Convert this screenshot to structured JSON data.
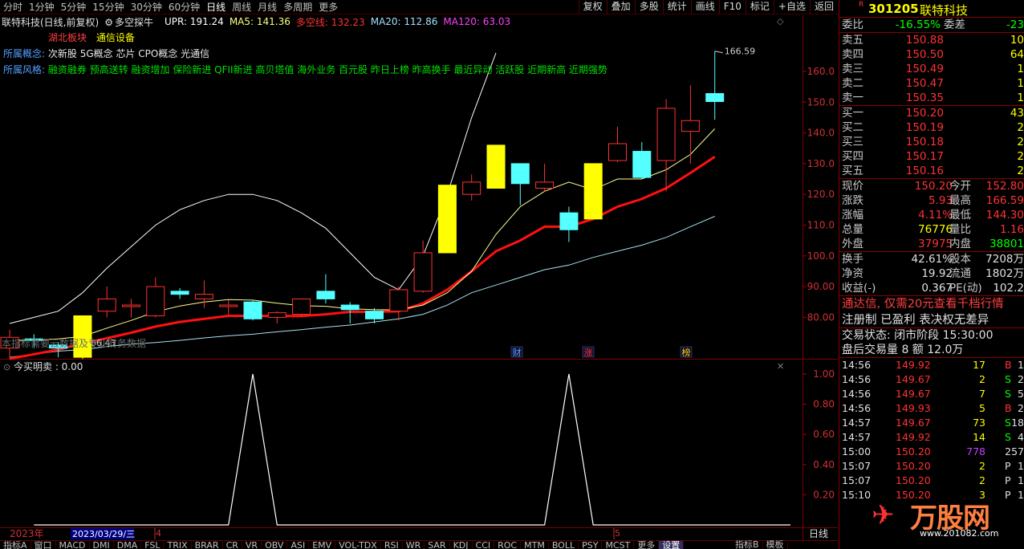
{
  "periods": [
    "分时",
    "1分钟",
    "5分钟",
    "15分钟",
    "30分钟",
    "60分钟",
    "日线",
    "周线",
    "月线",
    "多周期",
    "更多"
  ],
  "active_period": "日线",
  "top_buttons": [
    "复权",
    "叠加",
    "多股",
    "统计",
    "画线",
    "F10",
    "标记",
    "+自选",
    "返回"
  ],
  "stock": {
    "badge": "R",
    "code": "301205",
    "name": "联特科技"
  },
  "info_line": {
    "title": "联特科技(日线,前复权)",
    "indicator": "多空探牛",
    "upr": "UPR: 191.24",
    "ma5": "MA5: 141.36",
    "dkx": "多空线: 132.23",
    "ma20": "MA20: 112.86",
    "ma120": "MA120: 63.03"
  },
  "concepts": {
    "region_label": "湖北板块",
    "industry": "通信设备",
    "concept_label": "所属概念:",
    "concept_values": "次新股 5G概念 芯片 CPO概念 光通信",
    "style_label": "所属风格:",
    "style_values": "融资融券 预高送转 融资增加 保险新进 QFII新进 高贝塔值 海外业务 百元股 昨日上榜 昨高换手 最近异动 活跃股 近期新高 近期强势"
  },
  "chart_note": "本指标需要云数据及专业财务数据",
  "low_label": "66.43",
  "high_label": "166.59",
  "event_markers": [
    "财",
    "涨",
    "榜"
  ],
  "sub_indicator": {
    "label": "今买明卖 : 0.00"
  },
  "date_axis": {
    "year": "2023年",
    "cursor_date": "2023/03/29/三",
    "month4": "4",
    "month5": "5",
    "period_button": "日线"
  },
  "main_axis": [
    "160.0",
    "150.0",
    "140.0",
    "130.0",
    "120.0",
    "110.0",
    "100.0",
    "90.00",
    "80.00"
  ],
  "sub_axis": [
    "1.00",
    "0.80",
    "0.60",
    "0.40",
    "0.20"
  ],
  "colors": {
    "up": "#ff3232",
    "down": "#54ffff",
    "yellow": "#ffff00"
  },
  "candles": [
    {
      "o": 70.0,
      "h": 76.0,
      "l": 67.0,
      "c": 73.5
    },
    {
      "o": 73.0,
      "h": 74.5,
      "l": 70.0,
      "c": 72.5
    },
    {
      "o": 71.0,
      "h": 72.0,
      "l": 67.0,
      "c": 70.0
    },
    {
      "o": 67.0,
      "h": 80.5,
      "l": 66.43,
      "c": 80.5,
      "y": true
    },
    {
      "o": 82.0,
      "h": 90.0,
      "l": 80.0,
      "c": 86.0
    },
    {
      "o": 83.5,
      "h": 86.0,
      "l": 80.0,
      "c": 84.0
    },
    {
      "o": 80.5,
      "h": 93.0,
      "l": 80.0,
      "c": 90.0
    },
    {
      "o": 88.5,
      "h": 89.5,
      "l": 86.0,
      "c": 87.5
    },
    {
      "o": 86.0,
      "h": 92.0,
      "l": 83.0,
      "c": 87.5
    },
    {
      "o": 83.5,
      "h": 85.5,
      "l": 81.0,
      "c": 84.0
    },
    {
      "o": 85.0,
      "h": 85.5,
      "l": 79.0,
      "c": 79.5
    },
    {
      "o": 80.0,
      "h": 82.0,
      "l": 78.0,
      "c": 81.5
    },
    {
      "o": 81.0,
      "h": 84.0,
      "l": 80.0,
      "c": 86.0
    },
    {
      "o": 88.5,
      "h": 94.0,
      "l": 84.5,
      "c": 86.0
    },
    {
      "o": 84.0,
      "h": 85.0,
      "l": 78.0,
      "c": 82.5
    },
    {
      "o": 82.0,
      "h": 83.0,
      "l": 78.0,
      "c": 79.5
    },
    {
      "o": 82.0,
      "h": 90.0,
      "l": 79.0,
      "c": 89.0
    },
    {
      "o": 88.5,
      "h": 105.0,
      "l": 88.0,
      "c": 101.0
    },
    {
      "o": 101.0,
      "h": 123.0,
      "l": 101.0,
      "c": 123.0,
      "y": true
    },
    {
      "o": 120.0,
      "h": 126.5,
      "l": 118.0,
      "c": 124.0
    },
    {
      "o": 122.0,
      "h": 136.0,
      "l": 122.0,
      "c": 136.0,
      "y": true
    },
    {
      "o": 130.0,
      "h": 129.5,
      "l": 116.5,
      "c": 123.5
    },
    {
      "o": 122.0,
      "h": 130.0,
      "l": 121.0,
      "c": 124.0
    },
    {
      "o": 114.0,
      "h": 116.0,
      "l": 104.5,
      "c": 108.5
    },
    {
      "o": 112.0,
      "h": 130.0,
      "l": 112.0,
      "c": 130.0,
      "y": true
    },
    {
      "o": 131.0,
      "h": 142.0,
      "l": 130.5,
      "c": 136.5
    },
    {
      "o": 134.0,
      "h": 137.0,
      "l": 125.0,
      "c": 125.5
    },
    {
      "o": 131.0,
      "h": 151.0,
      "l": 121.0,
      "c": 148.0
    },
    {
      "o": 140.5,
      "h": 155.5,
      "l": 130.0,
      "c": 144.0
    },
    {
      "o": 152.8,
      "h": 166.59,
      "l": 144.3,
      "c": 150.2
    }
  ],
  "ma5": [
    72.5,
    72.6,
    73.0,
    73.8,
    76.5,
    79.0,
    81.8,
    83.7,
    85.0,
    85.8,
    85.6,
    84.6,
    83.8,
    83.6,
    82.8,
    82.5,
    82.4,
    84.0,
    88.0,
    95.0,
    107.0,
    116.0,
    121.0,
    124.0,
    121.5,
    125.0,
    125.0,
    128.0,
    133.0,
    141.36
  ],
  "dkx": [
    66.5,
    68.0,
    69.5,
    71.5,
    73.2,
    75.0,
    77.0,
    78.5,
    79.5,
    80.5,
    80.5,
    80.4,
    80.4,
    81.0,
    81.8,
    81.8,
    82.0,
    84.5,
    89.0,
    95.0,
    101.5,
    105.0,
    109.5,
    109.5,
    112.0,
    116.0,
    118.5,
    122.0,
    127.0,
    132.23
  ],
  "ma20": [
    67.0,
    68.0,
    69.0,
    69.5,
    70.5,
    71.3,
    71.8,
    72.5,
    73.3,
    74.0,
    74.5,
    75.3,
    76.0,
    76.8,
    77.5,
    78.5,
    79.5,
    81.0,
    84.0,
    88.0,
    90.5,
    93.0,
    95.5,
    97.0,
    99.5,
    101.5,
    103.5,
    106.0,
    109.5,
    112.86
  ],
  "upr": [
    78.0,
    80.0,
    82.0,
    88.0,
    96.0,
    103.0,
    110.0,
    115.0,
    118.0,
    120.0,
    120.0,
    118.0,
    114.0,
    109.0,
    101.0,
    93.0,
    89.0,
    100.0,
    120.0,
    145.0,
    166.0,
    null,
    null,
    null,
    null,
    null,
    null,
    null,
    null,
    null
  ],
  "signal": [
    0,
    0,
    0,
    0,
    0,
    0,
    0,
    0,
    0,
    0,
    1,
    0,
    0,
    0,
    0,
    0,
    0,
    0,
    0,
    0,
    0,
    0,
    0,
    1,
    0,
    0,
    0,
    0,
    0,
    0
  ],
  "order_book": {
    "weibi_label": "委比",
    "weibi": "-16.55%",
    "weicha_label": "委差",
    "weicha": "-23",
    "sells": [
      {
        "label": "卖五",
        "price": "150.88",
        "vol": "10"
      },
      {
        "label": "卖四",
        "price": "150.50",
        "vol": "64"
      },
      {
        "label": "卖三",
        "price": "150.49",
        "vol": "1"
      },
      {
        "label": "卖二",
        "price": "150.47",
        "vol": "1"
      },
      {
        "label": "卖一",
        "price": "150.35",
        "vol": "1"
      }
    ],
    "buys": [
      {
        "label": "买一",
        "price": "150.20",
        "vol": "43"
      },
      {
        "label": "买二",
        "price": "150.19",
        "vol": "2"
      },
      {
        "label": "买三",
        "price": "150.18",
        "vol": "2"
      },
      {
        "label": "买四",
        "price": "150.17",
        "vol": "2"
      },
      {
        "label": "买五",
        "price": "150.16",
        "vol": "2"
      }
    ]
  },
  "stats": [
    {
      "l1": "现价",
      "v1": "150.20",
      "c1": "#ff3232",
      "l2": "今开",
      "v2": "152.80",
      "c2": "#ff3232"
    },
    {
      "l1": "涨跌",
      "v1": "5.93",
      "c1": "#ff3232",
      "l2": "最高",
      "v2": "166.59",
      "c2": "#ff3232"
    },
    {
      "l1": "涨幅",
      "v1": "4.11%",
      "c1": "#ff3232",
      "l2": "最低",
      "v2": "144.30",
      "c2": "#ff3232"
    },
    {
      "l1": "总量",
      "v1": "76776",
      "c1": "#ffff00",
      "l2": "量比",
      "v2": "1.16",
      "c2": "#ff3232"
    },
    {
      "l1": "外盘",
      "v1": "37975",
      "c1": "#ff3232",
      "l2": "内盘",
      "v2": "38801",
      "c2": "#00ff00"
    },
    {
      "l1": "换手",
      "v1": "42.61%",
      "c1": "#e0e0e0",
      "l2": "股本",
      "v2": "7208万",
      "c2": "#e0e0e0"
    },
    {
      "l1": "净资",
      "v1": "19.92",
      "c1": "#e0e0e0",
      "l2": "流通",
      "v2": "1802万",
      "c2": "#e0e0e0"
    },
    {
      "l1": "收益(-)",
      "v1": "0.367",
      "c1": "#e0e0e0",
      "l2": "PE(动)",
      "v2": "102.2",
      "c2": "#e0e0e0"
    }
  ],
  "promo": "通达信, 仅需20元查看千档行情",
  "register": "注册制 已盈利 表决权无差异",
  "trade_status": "交易状态: 闭市阶段 15:30:00",
  "after_hours": "盘后交易量 8 额 12.0万",
  "ticks": [
    {
      "t": "14:56",
      "p": "149.92",
      "v": "17",
      "s": "B",
      "n": "1"
    },
    {
      "t": "14:56",
      "p": "149.67",
      "v": "2",
      "s": "S",
      "n": "2"
    },
    {
      "t": "14:56",
      "p": "149.67",
      "v": "7",
      "s": "S",
      "n": "5"
    },
    {
      "t": "14:56",
      "p": "149.93",
      "v": "5",
      "s": "B",
      "n": "2"
    },
    {
      "t": "14:57",
      "p": "149.67",
      "v": "73",
      "s": "S",
      "n": "18"
    },
    {
      "t": "14:57",
      "p": "149.92",
      "v": "14",
      "s": "S",
      "n": "4"
    },
    {
      "t": "15:00",
      "p": "150.20",
      "v": "778",
      "s": "",
      "n": "257"
    },
    {
      "t": "15:07",
      "p": "150.20",
      "v": "2",
      "s": "P",
      "n": "1"
    },
    {
      "t": "15:07",
      "p": "150.20",
      "v": "2",
      "s": "P",
      "n": "1"
    },
    {
      "t": "15:10",
      "p": "150.20",
      "v": "3",
      "s": "P",
      "n": "1"
    }
  ],
  "watermark": {
    "text": "万股网",
    "url": "www.201082.com"
  },
  "bottom_tabs": [
    "指标A",
    "窗口",
    "MACD",
    "DMI",
    "DMA",
    "FSL",
    "TRIX",
    "BRAR",
    "CR",
    "VR",
    "OBV",
    "ASI",
    "EMV",
    "VOL-TDX",
    "RSI",
    "WR",
    "SAR",
    "KDJ",
    "CCI",
    "ROC",
    "MTM",
    "BOLL",
    "PSY",
    "MCST",
    "更多",
    "设置"
  ],
  "bottom_right_tabs": [
    "指标B",
    "模板"
  ]
}
